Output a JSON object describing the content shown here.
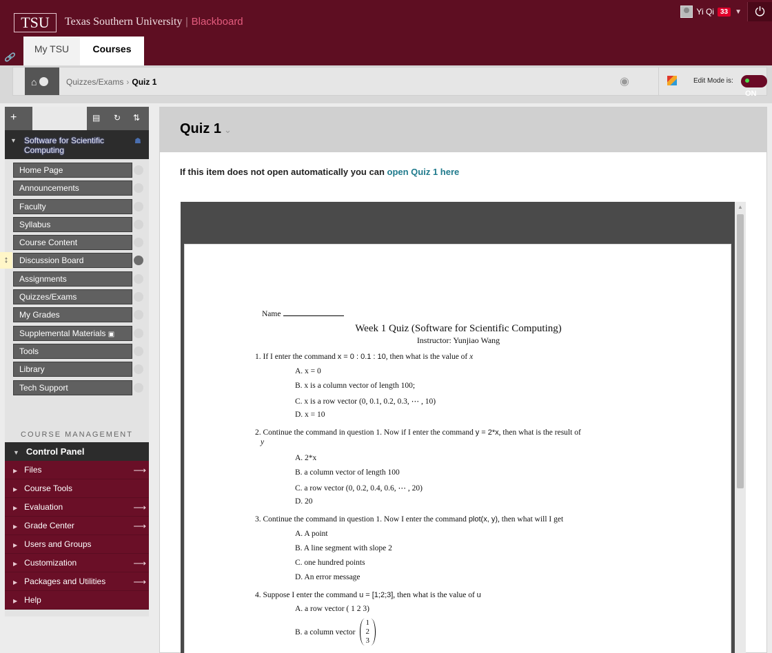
{
  "header": {
    "logo": "TSU",
    "university": "Texas Southern University",
    "separator": "|",
    "platform": "Blackboard",
    "tabs": [
      "My TSU",
      "Courses"
    ],
    "user_name": "Yi Qi",
    "notification_count": "33",
    "colors": {
      "brand": "#5e0e22",
      "badge": "#e0002a"
    }
  },
  "breadcrumb": {
    "parent": "Quizzes/Exams",
    "arrow": "›",
    "current": "Quiz 1",
    "edit_mode_label": "Edit Mode is:",
    "edit_mode_state": "ON"
  },
  "leftmenu": {
    "course_title": "Software for Scientific Computing",
    "items": [
      {
        "label": "Home Page"
      },
      {
        "label": "Announcements"
      },
      {
        "label": "Faculty"
      },
      {
        "label": "Syllabus"
      },
      {
        "label": "Course Content"
      },
      {
        "label": "Discussion Board"
      },
      {
        "label": "Assignments"
      },
      {
        "label": "Quizzes/Exams"
      },
      {
        "label": "My Grades"
      },
      {
        "label": "Supplemental Materials"
      },
      {
        "label": "Tools"
      },
      {
        "label": "Library"
      },
      {
        "label": "Tech Support"
      }
    ],
    "management_title": "COURSE MANAGEMENT",
    "control_panel": "Control Panel",
    "cp_items": [
      {
        "label": "Files",
        "arrow": true
      },
      {
        "label": "Course Tools",
        "arrow": false
      },
      {
        "label": "Evaluation",
        "arrow": true
      },
      {
        "label": "Grade Center",
        "arrow": true
      },
      {
        "label": "Users and Groups",
        "arrow": false
      },
      {
        "label": "Customization",
        "arrow": true
      },
      {
        "label": "Packages and Utilities",
        "arrow": true
      },
      {
        "label": "Help",
        "arrow": false
      }
    ]
  },
  "content": {
    "title": "Quiz 1",
    "notice_prefix": "If this item does not open automatically you can",
    "notice_link": "open Quiz 1 here",
    "document": {
      "name_label": "Name",
      "title": "Week 1 Quiz (Software for Scientific Computing)",
      "instructor": "Instructor: Yunjiao Wang",
      "q1": {
        "text_a": "1. If I enter the command",
        "cmd": "x = 0 : 0.1 : 10",
        "text_b": ", then what is the value of",
        "var": "x",
        "options": [
          "A. x = 0",
          "B. x is a column vector of length 100;",
          "C. x is a row vector (0, 0.1, 0.2, 0.3, ⋯ , 10)",
          "D. x = 10"
        ]
      },
      "q2": {
        "text_a": "2. Continue the command in question 1. Now if I enter the command",
        "cmd": "y = 2*x",
        "text_b": ", then what is the result of",
        "var": "y",
        "options": [
          "A. 2*x",
          "B. a column vector of length 100",
          "C. a row vector (0, 0.2, 0.4, 0.6, ⋯ , 20)",
          "D. 20"
        ]
      },
      "q3": {
        "text_a": "3. Continue the command in question 1. Now I enter the command",
        "cmd": "plot(x, y)",
        "text_b": ", then what will I get",
        "options": [
          "A. A point",
          "B. A line segment with slope 2",
          "C. one hundred points",
          "D. An error message"
        ]
      },
      "q4": {
        "text_a": "4. Suppose I enter the command",
        "cmd": "u = [1;2;3]",
        "text_b": ", then what is the value of",
        "var": "u",
        "opt_a": "A. a row vector ( 1 2 3)",
        "opt_b": "B. a column vector",
        "vector": [
          "1",
          "2",
          "3"
        ]
      }
    }
  }
}
